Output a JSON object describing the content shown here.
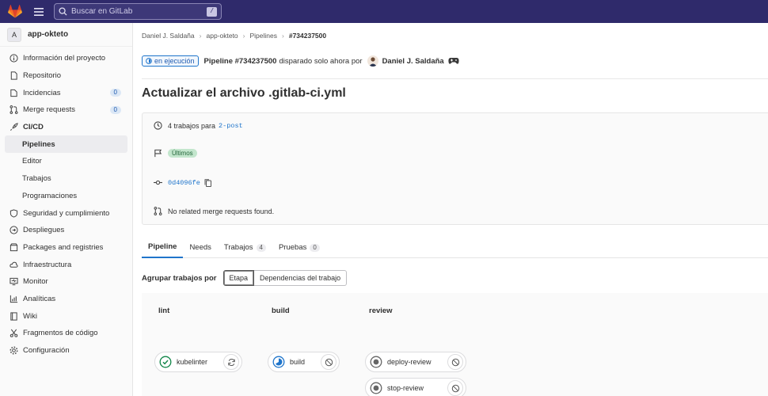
{
  "topbar": {
    "search_placeholder": "Buscar en GitLab",
    "search_shortcut": "/"
  },
  "sidebar": {
    "project_initial": "A",
    "project_name": "app-okteto",
    "items": [
      {
        "label": "Información del proyecto",
        "icon": "info-icon"
      },
      {
        "label": "Repositorio",
        "icon": "doc-icon"
      },
      {
        "label": "Incidencias",
        "icon": "issues-icon",
        "count": "0"
      },
      {
        "label": "Merge requests",
        "icon": "merge-request-icon",
        "count": "0"
      },
      {
        "label": "CI/CD",
        "icon": "rocket-icon"
      },
      {
        "label": "Pipelines",
        "sub": true,
        "active": true
      },
      {
        "label": "Editor",
        "sub": true
      },
      {
        "label": "Trabajos",
        "sub": true
      },
      {
        "label": "Programaciones",
        "sub": true
      },
      {
        "label": "Seguridad y cumplimiento",
        "icon": "shield-icon"
      },
      {
        "label": "Despliegues",
        "icon": "deploy-icon"
      },
      {
        "label": "Packages and registries",
        "icon": "package-icon"
      },
      {
        "label": "Infraestructura",
        "icon": "cloud-icon"
      },
      {
        "label": "Monitor",
        "icon": "monitor-icon"
      },
      {
        "label": "Analíticas",
        "icon": "chart-icon"
      },
      {
        "label": "Wiki",
        "icon": "book-icon"
      },
      {
        "label": "Fragmentos de código",
        "icon": "snippet-icon"
      },
      {
        "label": "Configuración",
        "icon": "settings-icon"
      }
    ]
  },
  "breadcrumb": [
    "Daniel J. Saldaña",
    "app-okteto",
    "Pipelines",
    "#734237500"
  ],
  "pipeline_header": {
    "status": "en ejecución",
    "pipeline_label": "Pipeline #734237500",
    "triggered_text": "disparado solo ahora por",
    "user": "Daniel J. Saldaña"
  },
  "title": "Actualizar el archivo .gitlab-ci.yml",
  "info": {
    "jobs_text": "4 trabajos para",
    "branch": "2-post",
    "latest_badge": "Últimos",
    "commit_sha": "0d4096fe",
    "mr_text": "No related merge requests found."
  },
  "tabs": [
    {
      "label": "Pipeline",
      "active": true
    },
    {
      "label": "Needs"
    },
    {
      "label": "Trabajos",
      "count": "4"
    },
    {
      "label": "Pruebas",
      "count": "0"
    }
  ],
  "grouping": {
    "label": "Agrupar trabajos por",
    "options": [
      "Etapa",
      "Dependencias del trabajo"
    ],
    "selected": "Etapa"
  },
  "stages": [
    {
      "name": "lint",
      "jobs": [
        {
          "name": "kubelinter",
          "status": "passed",
          "action": "retry"
        }
      ]
    },
    {
      "name": "build",
      "jobs": [
        {
          "name": "build",
          "status": "running",
          "action": "cancel"
        }
      ]
    },
    {
      "name": "review",
      "jobs": [
        {
          "name": "deploy-review",
          "status": "created",
          "action": "cancel"
        },
        {
          "name": "stop-review",
          "status": "created",
          "action": "cancel"
        }
      ]
    }
  ],
  "colors": {
    "topbar": "#2f2a6b",
    "link": "#1f75cb",
    "success": "#108548",
    "running": "#1f75cb"
  }
}
